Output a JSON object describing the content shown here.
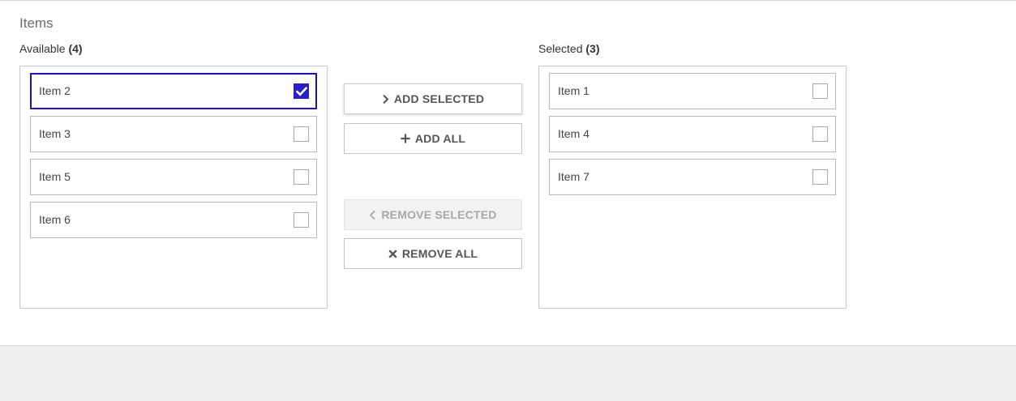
{
  "section": {
    "title": "Items"
  },
  "available": {
    "label": "Available",
    "count": "(4)",
    "items": [
      {
        "label": "Item 2",
        "checked": true
      },
      {
        "label": "Item 3",
        "checked": false
      },
      {
        "label": "Item 5",
        "checked": false
      },
      {
        "label": "Item 6",
        "checked": false
      }
    ]
  },
  "selected": {
    "label": "Selected",
    "count": "(3)",
    "items": [
      {
        "label": "Item 1",
        "checked": false
      },
      {
        "label": "Item 4",
        "checked": false
      },
      {
        "label": "Item 7",
        "checked": false
      }
    ]
  },
  "actions": {
    "add_selected": {
      "label": "ADD SELECTED",
      "icon": "chevron-right-icon",
      "enabled": true
    },
    "add_all": {
      "label": "ADD ALL",
      "icon": "plus-icon",
      "enabled": true
    },
    "remove_selected": {
      "label": "REMOVE SELECTED",
      "icon": "chevron-left-icon",
      "enabled": false
    },
    "remove_all": {
      "label": "REMOVE ALL",
      "icon": "close-icon",
      "enabled": true
    }
  },
  "colors": {
    "accent": "#2a1fc4",
    "focus_border": "#1a14b5",
    "disabled_text": "#a8a8a8",
    "footer_bg": "#efefef"
  }
}
